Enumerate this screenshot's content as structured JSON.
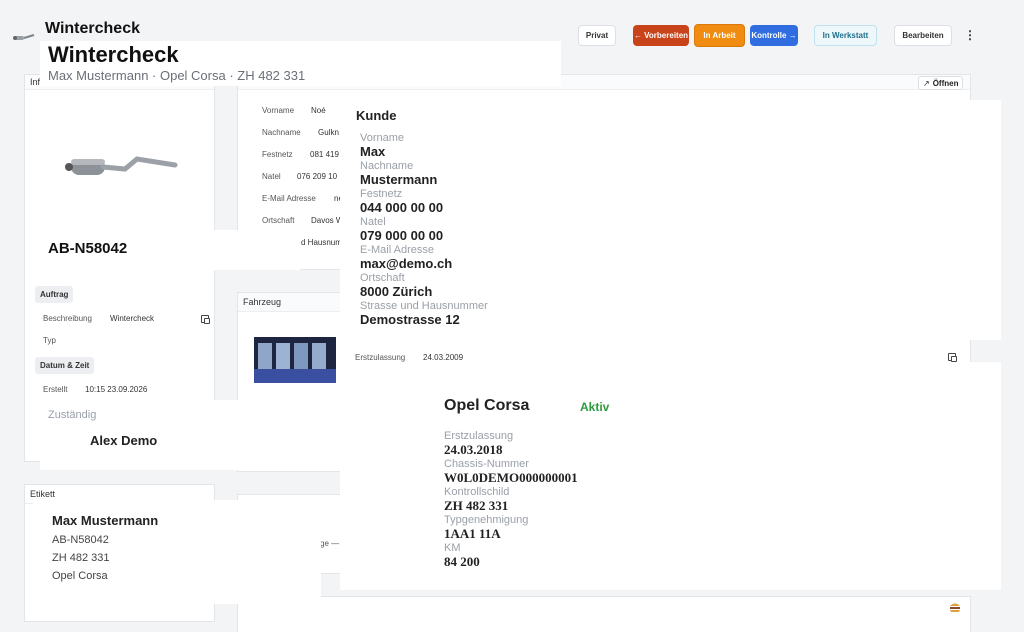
{
  "header": {
    "app_title": "Wintercheck",
    "title": "Wintercheck",
    "subtitle": "Max Mustermann · Opel Corsa · ZH 482 331"
  },
  "toolbar": {
    "privat": "Privat",
    "vorbereiten": "← Vorbereiten",
    "in_arbeit": "In Arbeit",
    "kontrolle": "Kontrolle →",
    "in_werkstatt": "In Werkstatt",
    "bearbeiten": "Bearbeiten",
    "more": "⋮"
  },
  "informationen": {
    "title": "Informationen",
    "order_number": "AB-N58042",
    "auftrag_label": "Auftrag",
    "beschreibung_label": "Beschreibung",
    "beschreibung_value": "Wintercheck",
    "typ_label": "Typ",
    "datum_label": "Datum & Zeit",
    "erstellt_label": "Erstellt",
    "erstellt_value": "10:15 23.09.2026",
    "zustaendig_label": "Zuständig",
    "zustaendig_value": "Alex Demo"
  },
  "kunde_bg": {
    "title": "Kunde",
    "open": "Öffnen",
    "vorname_label": "Vorname",
    "vorname_value": "Noé",
    "nachname_label": "Nachname",
    "nachname_value": "Gulkn",
    "festnetz_label": "Festnetz",
    "festnetz_value": "081 419",
    "natel_label": "Natel",
    "natel_value": "076 209 10",
    "email_label": "E-Mail Adresse",
    "email_value": "ne",
    "ortschaft_label": "Ortschaft",
    "ortschaft_value": "Davos W",
    "strasse_value": "d Hausnum"
  },
  "kunde": {
    "title": "Kunde",
    "fields": [
      {
        "label": "Vorname",
        "value": "Max"
      },
      {
        "label": "Nachname",
        "value": "Mustermann"
      },
      {
        "label": "Festnetz",
        "value": "044 000 00 00"
      },
      {
        "label": "Natel",
        "value": "079 000 00 00"
      },
      {
        "label": "E-Mail Adresse",
        "value": "max@demo.ch"
      },
      {
        "label": "Ortschaft",
        "value": "8000 Zürich"
      },
      {
        "label": "Strasse und Hausnummer",
        "value": "Demostrasse 12"
      }
    ]
  },
  "fahrzeug_bg": {
    "title": "Fahrzeug",
    "erstzulassung_label": "Erstzulassung",
    "erstzulassung_value": "24.03.2009"
  },
  "fahrzeug": {
    "name": "Opel Corsa",
    "status": "Aktiv",
    "fields": [
      {
        "label": "Erstzulassung",
        "value": "24.03.2018"
      },
      {
        "label": "Chassis-Nummer",
        "value": "W0L0DEMO000000001"
      },
      {
        "label": "Kontrollschild",
        "value": "ZH 482 331"
      },
      {
        "label": "Typgenehmigung",
        "value": "1AA1 11A"
      },
      {
        "label": "KM",
        "value": "84 200"
      }
    ]
  },
  "etikett": {
    "title": "Etikett",
    "name": "Max Mustermann",
    "line1": "AB-N58042",
    "line2": "ZH 482 331",
    "line3": "Opel Corsa"
  },
  "misc": {
    "bg_text": "ge —"
  },
  "colors": {
    "vorbereiten": "#c8431a",
    "in_arbeit": "#f08c12",
    "kontrolle": "#2f6de0",
    "aktiv": "#2e9a3e"
  }
}
